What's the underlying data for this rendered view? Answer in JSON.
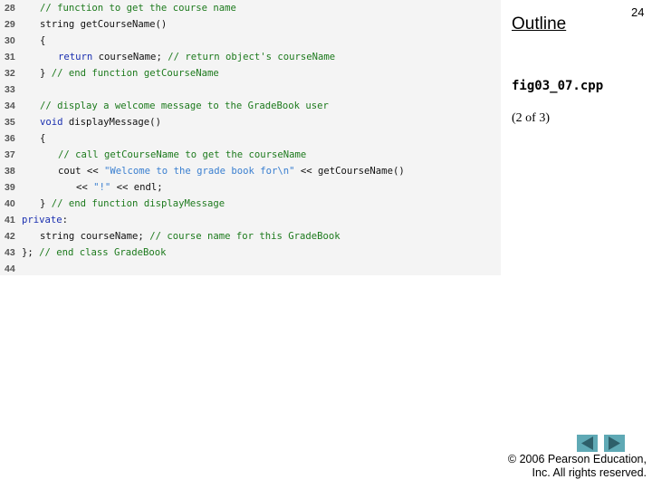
{
  "code_lines": [
    {
      "n": "28",
      "indent": 1,
      "tokens": [
        {
          "t": "// function to get the course name",
          "c": "cm"
        }
      ]
    },
    {
      "n": "29",
      "indent": 1,
      "tokens": [
        {
          "t": "string getCourseName()",
          "c": ""
        }
      ]
    },
    {
      "n": "30",
      "indent": 1,
      "tokens": [
        {
          "t": "{",
          "c": ""
        }
      ]
    },
    {
      "n": "31",
      "indent": 2,
      "tokens": [
        {
          "t": "return",
          "c": "kw"
        },
        {
          "t": " courseName; ",
          "c": ""
        },
        {
          "t": "// return object's courseName",
          "c": "cm"
        }
      ]
    },
    {
      "n": "32",
      "indent": 1,
      "tokens": [
        {
          "t": "} ",
          "c": ""
        },
        {
          "t": "// end function getCourseName",
          "c": "cm"
        }
      ]
    },
    {
      "n": "33",
      "indent": 0,
      "tokens": []
    },
    {
      "n": "34",
      "indent": 1,
      "tokens": [
        {
          "t": "// display a welcome message to the GradeBook user",
          "c": "cm"
        }
      ]
    },
    {
      "n": "35",
      "indent": 1,
      "tokens": [
        {
          "t": "void",
          "c": "kw"
        },
        {
          "t": " displayMessage()",
          "c": ""
        }
      ]
    },
    {
      "n": "36",
      "indent": 1,
      "tokens": [
        {
          "t": "{",
          "c": ""
        }
      ]
    },
    {
      "n": "37",
      "indent": 2,
      "tokens": [
        {
          "t": "// call getCourseName to get the courseName",
          "c": "cm"
        }
      ]
    },
    {
      "n": "38",
      "indent": 2,
      "tokens": [
        {
          "t": "cout << ",
          "c": ""
        },
        {
          "t": "\"Welcome to the grade book for\\n\"",
          "c": "st"
        },
        {
          "t": " << getCourseName()",
          "c": ""
        }
      ]
    },
    {
      "n": "39",
      "indent": 3,
      "tokens": [
        {
          "t": "<< ",
          "c": ""
        },
        {
          "t": "\"!\"",
          "c": "st"
        },
        {
          "t": " << endl;",
          "c": ""
        }
      ]
    },
    {
      "n": "40",
      "indent": 1,
      "tokens": [
        {
          "t": "} ",
          "c": ""
        },
        {
          "t": "// end function displayMessage",
          "c": "cm"
        }
      ]
    },
    {
      "n": "41",
      "indent": 0,
      "tokens": [
        {
          "t": "private",
          "c": "kw"
        },
        {
          "t": ":",
          "c": ""
        }
      ]
    },
    {
      "n": "42",
      "indent": 1,
      "tokens": [
        {
          "t": "string courseName; ",
          "c": ""
        },
        {
          "t": "// course name for this GradeBook",
          "c": "cm"
        }
      ]
    },
    {
      "n": "43",
      "indent": 0,
      "tokens": [
        {
          "t": "}; ",
          "c": ""
        },
        {
          "t": "// end class GradeBook",
          "c": "cm"
        }
      ]
    },
    {
      "n": "44",
      "indent": 0,
      "tokens": []
    }
  ],
  "sidebar": {
    "outline": "Outline",
    "page_number": "24",
    "filename": "fig03_07.cpp",
    "part": "(2 of 3)"
  },
  "nav": {
    "prev_icon": "triangle-left-icon",
    "next_icon": "triangle-right-icon"
  },
  "footer": {
    "line1": "© 2006 Pearson Education,",
    "line2": "Inc.  All rights reserved."
  }
}
